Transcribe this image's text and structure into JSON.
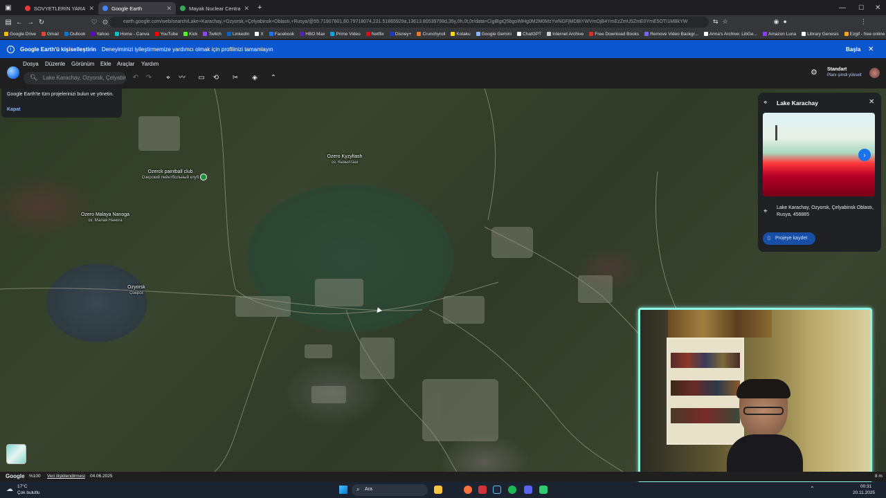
{
  "browser": {
    "tabs": [
      {
        "title": "SOVYETLERİN YARATTIĞI DÜNYA",
        "color": "#e53935",
        "active": false
      },
      {
        "title": "Google Earth",
        "color": "#4285f4",
        "active": true
      },
      {
        "title": "Mayak Nuclear Central - Googl",
        "color": "#34a853",
        "active": false
      }
    ],
    "new_tab": "+",
    "url": "earth.google.com/web/search/Lake+Karachay,+Ozyorsk,+Çelyabinsk+Oblastı,+Rusya/@55.71907601,60.79718074,231.51865929a,13613.80539798d,35y,0h,0t,0r/data=CigiBgiQ5bgoIMHg0M2M0MzYwNGFjMDBiYWVmOjB4YmEzZmU5ZmE0YmE5OTI1MBkYW"
  },
  "bookmarks": [
    {
      "label": "Google Drive",
      "color": "#fbbc04"
    },
    {
      "label": "Gmail",
      "color": "#ea4335"
    },
    {
      "label": "Outlook",
      "color": "#0078d4"
    },
    {
      "label": "Yahoo",
      "color": "#6001d2"
    },
    {
      "label": "Home - Canva",
      "color": "#00c4cc"
    },
    {
      "label": "YouTube",
      "color": "#ff0000"
    },
    {
      "label": "Kick",
      "color": "#53fc18"
    },
    {
      "label": "Twitch",
      "color": "#9146ff"
    },
    {
      "label": "LinkedIn",
      "color": "#0a66c2"
    },
    {
      "label": "X",
      "color": "#ffffff"
    },
    {
      "label": "Facebook",
      "color": "#1877f2"
    },
    {
      "label": "HBO Max",
      "color": "#5822b4"
    },
    {
      "label": "Prime Video",
      "color": "#00a8e1"
    },
    {
      "label": "Netflix",
      "color": "#e50914"
    },
    {
      "label": "Disney+",
      "color": "#113ccf"
    },
    {
      "label": "Crunchyroll",
      "color": "#f47521"
    },
    {
      "label": "Kotaku",
      "color": "#ffd700"
    },
    {
      "label": "Google Gemini",
      "color": "#8ab4f8"
    },
    {
      "label": "ChatGPT",
      "color": "#ffffff"
    },
    {
      "label": "Internet Archive",
      "color": "#cccccc"
    },
    {
      "label": "Free Download Books",
      "color": "#d93025"
    },
    {
      "label": "Remove Video Backgr...",
      "color": "#7b61ff"
    },
    {
      "label": "Anna's Archive: LibGe...",
      "color": "#ffffff"
    },
    {
      "label": "Amazon Luna",
      "color": "#8c3bff"
    },
    {
      "label": "Library Genesis",
      "color": "#ffffff"
    },
    {
      "label": "Ezgif - free online ani...",
      "color": "#f5a623"
    }
  ],
  "notice": {
    "title": "Google Earth'ü kişiselleştirin",
    "text": "Deneyiminizi iyileştirmemize yardımcı olmak için profilinizi tamamlayın",
    "action": "Başla"
  },
  "menu": [
    "Dosya",
    "Düzenle",
    "Görünüm",
    "Ekle",
    "Araçlar",
    "Yardım"
  ],
  "search": {
    "placeholder": "Lake Karachay, Ozyorsk, Çelyabinsk"
  },
  "account": {
    "plan": "Standart",
    "upgrade": "Planı şimdi yükselt"
  },
  "tooltip": {
    "text": "Google Earth'te tüm projelerinizi bulun ve yönetin.",
    "close": "Kapat"
  },
  "map_labels": [
    {
      "name": "Ozerck paintball club",
      "sub": "Озерский пейнтбольный клуб"
    },
    {
      "name": "Ozero Kyzyltash",
      "sub": "оз. Кызылташ"
    },
    {
      "name": "Ozero Malaya Nanoga",
      "sub": "оз. Малая Наноrа"
    },
    {
      "name": "Ozyorsk",
      "sub": "Озерск"
    }
  ],
  "place": {
    "title": "Lake Karachay",
    "address": "Lake Karachay, Ozyorsk, Çelyabinsk Oblastı, Rusya, 456885",
    "save": "Projeye kaydet"
  },
  "statusbar": {
    "brand": "Google",
    "zoom": "%100",
    "credits": "Veri ilişkilendirmesi",
    "date": "04.06.2025",
    "scale": "8 m"
  },
  "taskbar": {
    "temp": "17°C",
    "weather": "Çok bulutlu",
    "search": "Ara",
    "time": "00:31",
    "date": "20.11.2025"
  }
}
